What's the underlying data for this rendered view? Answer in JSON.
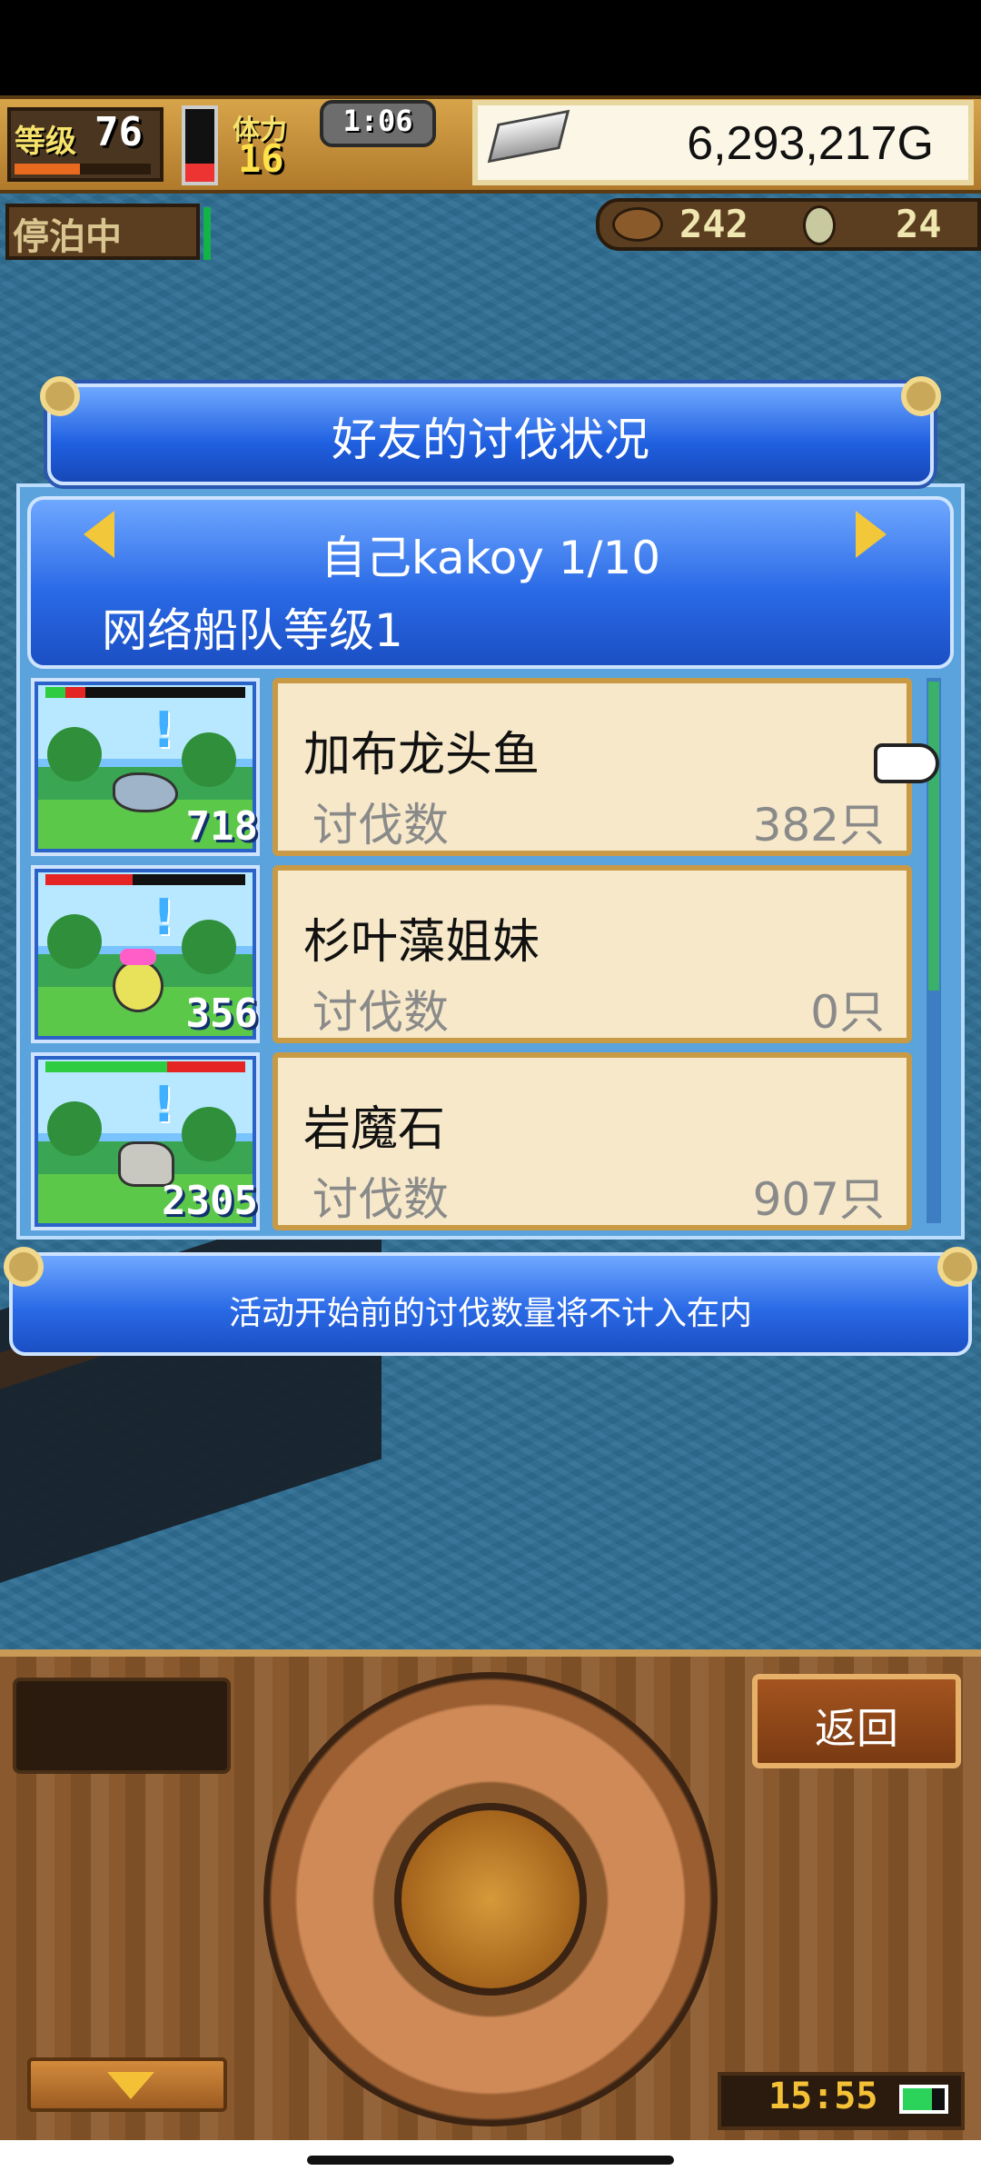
{
  "hud": {
    "level_label": "等级",
    "level_value": "76",
    "stamina_label": "体力",
    "stamina_value": "16",
    "timer": "1:06",
    "gold": "6,293,217G",
    "dock_status": "停泊中",
    "resource_1": "242",
    "resource_2": "24"
  },
  "dialog": {
    "title": "好友的讨伐状况",
    "player_name": "自己kakoy 1/10",
    "fleet_level": "网络船队等级1",
    "rows": [
      {
        "name": "加布龙头鱼",
        "label": "讨伐数",
        "count": "382只",
        "monster_count": "718"
      },
      {
        "name": "杉叶藻姐妹",
        "label": "讨伐数",
        "count": "0只",
        "monster_count": "356"
      },
      {
        "name": "岩魔石",
        "label": "讨伐数",
        "count": "907只",
        "monster_count": "2305"
      }
    ],
    "notice": "活动开始前的讨伐数量将不计入在内"
  },
  "console": {
    "back_label": "返回",
    "clock": "15:55"
  },
  "icons": {
    "gold": "silver-bar-icon",
    "resource_1": "meat-icon",
    "resource_2": "coin-icon",
    "pointer": "pointing-hand-icon"
  }
}
